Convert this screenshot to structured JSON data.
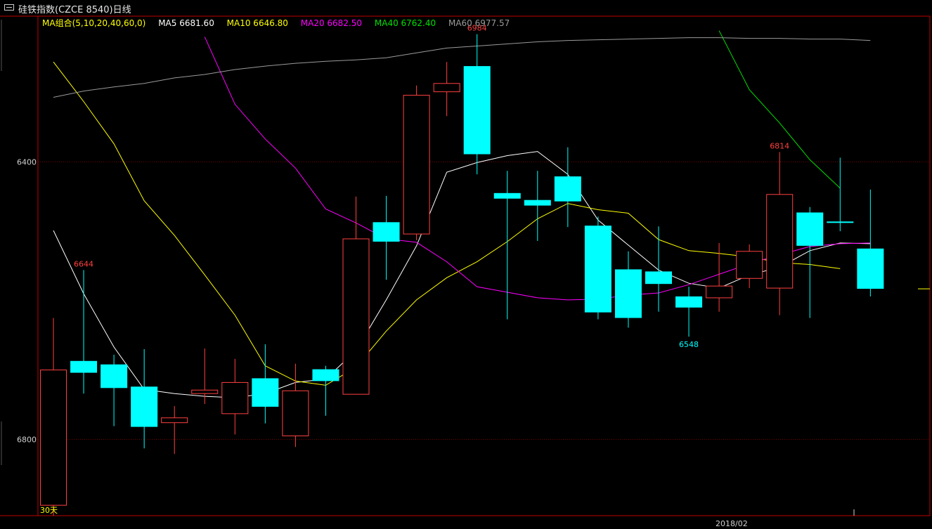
{
  "window": {
    "title": "硅铁指数(CZCE 8540)日线"
  },
  "legend": {
    "group": "MA组合(5,10,20,40,60,0)",
    "items": [
      {
        "label": "MA5 6681.60",
        "color": "#ffffff"
      },
      {
        "label": "MA10 6646.80",
        "color": "#ffff00"
      },
      {
        "label": "MA20 6682.50",
        "color": "#ff00ff"
      },
      {
        "label": "MA40 6762.40",
        "color": "#00e000"
      },
      {
        "label": "MA60 6977.57",
        "color": "#9a9a9a"
      }
    ],
    "group_color": "#ffff00"
  },
  "axis": {
    "y_ticks": [
      "6800",
      "6400"
    ],
    "x_ticks": [
      "2018/02"
    ],
    "corner_label": "30天"
  },
  "colors": {
    "up": "#ff4040",
    "down": "#00ffff",
    "frame": "#c00000",
    "gridline": "#800000",
    "background": "#000000"
  },
  "chart_data": {
    "type": "candlestick",
    "title": "硅铁指数(CZCE 8540)日线",
    "ylim": [
      6290,
      7010
    ],
    "y_ticks": [
      6400,
      6800
    ],
    "x_ticks": [
      "2018/02"
    ],
    "candles": [
      {
        "o": 6305,
        "c": 6500,
        "h": 6575,
        "l": 6290
      },
      {
        "o": 6513,
        "c": 6496,
        "h": 6644,
        "l": 6466
      },
      {
        "o": 6508,
        "c": 6474,
        "h": 6522,
        "l": 6419
      },
      {
        "o": 6476,
        "c": 6418,
        "h": 6530,
        "l": 6387
      },
      {
        "o": 6424,
        "c": 6431,
        "h": 6448,
        "l": 6379
      },
      {
        "o": 6466,
        "c": 6471,
        "h": 6531,
        "l": 6451
      },
      {
        "o": 6437,
        "c": 6482,
        "h": 6516,
        "l": 6407
      },
      {
        "o": 6488,
        "c": 6447,
        "h": 6537,
        "l": 6423
      },
      {
        "o": 6405,
        "c": 6470,
        "h": 6509,
        "l": 6389
      },
      {
        "o": 6501,
        "c": 6484,
        "h": 6506,
        "l": 6434
      },
      {
        "o": 6465,
        "c": 6689,
        "h": 6750,
        "l": 6465
      },
      {
        "o": 6713,
        "c": 6685,
        "h": 6751,
        "l": 6630
      },
      {
        "o": 6696,
        "c": 6896,
        "h": 6910,
        "l": 6687
      },
      {
        "o": 6901,
        "c": 6913,
        "h": 6944,
        "l": 6866
      },
      {
        "o": 6938,
        "c": 6811,
        "h": 6984,
        "l": 6782
      },
      {
        "o": 6755,
        "c": 6747,
        "h": 6787,
        "l": 6573
      },
      {
        "o": 6745,
        "c": 6737,
        "h": 6787,
        "l": 6686
      },
      {
        "o": 6779,
        "c": 6743,
        "h": 6821,
        "l": 6706
      },
      {
        "o": 6708,
        "c": 6583,
        "h": 6721,
        "l": 6573
      },
      {
        "o": 6645,
        "c": 6575,
        "h": 6671,
        "l": 6561
      },
      {
        "o": 6642,
        "c": 6624,
        "h": 6707,
        "l": 6584
      },
      {
        "o": 6606,
        "c": 6590,
        "h": 6620,
        "l": 6548
      },
      {
        "o": 6604,
        "c": 6621,
        "h": 6683,
        "l": 6584
      },
      {
        "o": 6632,
        "c": 6671,
        "h": 6681,
        "l": 6618
      },
      {
        "o": 6618,
        "c": 6753,
        "h": 6814,
        "l": 6579
      },
      {
        "o": 6727,
        "c": 6679,
        "h": 6735,
        "l": 6575
      },
      {
        "o": 6714,
        "c": 6712,
        "h": 6806,
        "l": 6700
      },
      {
        "o": 6675,
        "c": 6617,
        "h": 6760,
        "l": 6606
      }
    ],
    "annotations": [
      {
        "index": 1,
        "value": 6644,
        "text": "6644",
        "position": "above",
        "color": "#ff4040"
      },
      {
        "index": 14,
        "value": 6984,
        "text": "6984",
        "position": "above",
        "color": "#ff4040"
      },
      {
        "index": 21,
        "value": 6548,
        "text": "6548",
        "position": "below",
        "color": "#00ffff"
      },
      {
        "index": 24,
        "value": 6814,
        "text": "6814",
        "position": "above",
        "color": "#ff4040"
      }
    ],
    "series": [
      {
        "name": "MA5",
        "color": "#ffffff",
        "start": 0,
        "values": [
          6701,
          6610,
          6533,
          6472,
          6466,
          6462,
          6460,
          6466,
          6482,
          6487,
          6528,
          6601,
          6679,
          6785,
          6799,
          6809,
          6815,
          6782,
          6716,
          6680,
          6644,
          6625,
          6618,
          6637,
          6648,
          6672,
          6683,
          6682
        ]
      },
      {
        "name": "MA10",
        "color": "#ffff00",
        "start": 0,
        "values": [
          6944,
          6887,
          6826,
          6744,
          6694,
          6637,
          6579,
          6506,
          6484,
          6478,
          6504,
          6556,
          6601,
          6633,
          6656,
          6685,
          6718,
          6740,
          6731,
          6726,
          6688,
          6672,
          6668,
          6663,
          6655,
          6652,
          6646
        ]
      },
      {
        "name": "MA20",
        "color": "#ff00ff",
        "start": 5,
        "values": [
          6980,
          6883,
          6833,
          6791,
          6732,
          6712,
          6689,
          6684,
          6656,
          6620,
          6612,
          6604,
          6601,
          6602,
          6608,
          6611,
          6623,
          6638,
          6653,
          6666,
          6678,
          6682,
          6683
        ]
      },
      {
        "name": "MA40",
        "color": "#00e000",
        "start": 22,
        "values": [
          6989,
          6904,
          6856,
          6803,
          6762
        ]
      },
      {
        "name": "MA60",
        "color": "#9a9a9a",
        "start": 0,
        "values": [
          6893,
          6902,
          6908,
          6913,
          6921,
          6926,
          6933,
          6938,
          6942,
          6945,
          6947,
          6950,
          6957,
          6964,
          6967,
          6970,
          6973,
          6975,
          6976,
          6977,
          6978,
          6979,
          6979,
          6978,
          6978,
          6977,
          6977,
          6975
        ]
      }
    ],
    "last_price_marker": 6617,
    "grid": "horizontal-dotted"
  }
}
